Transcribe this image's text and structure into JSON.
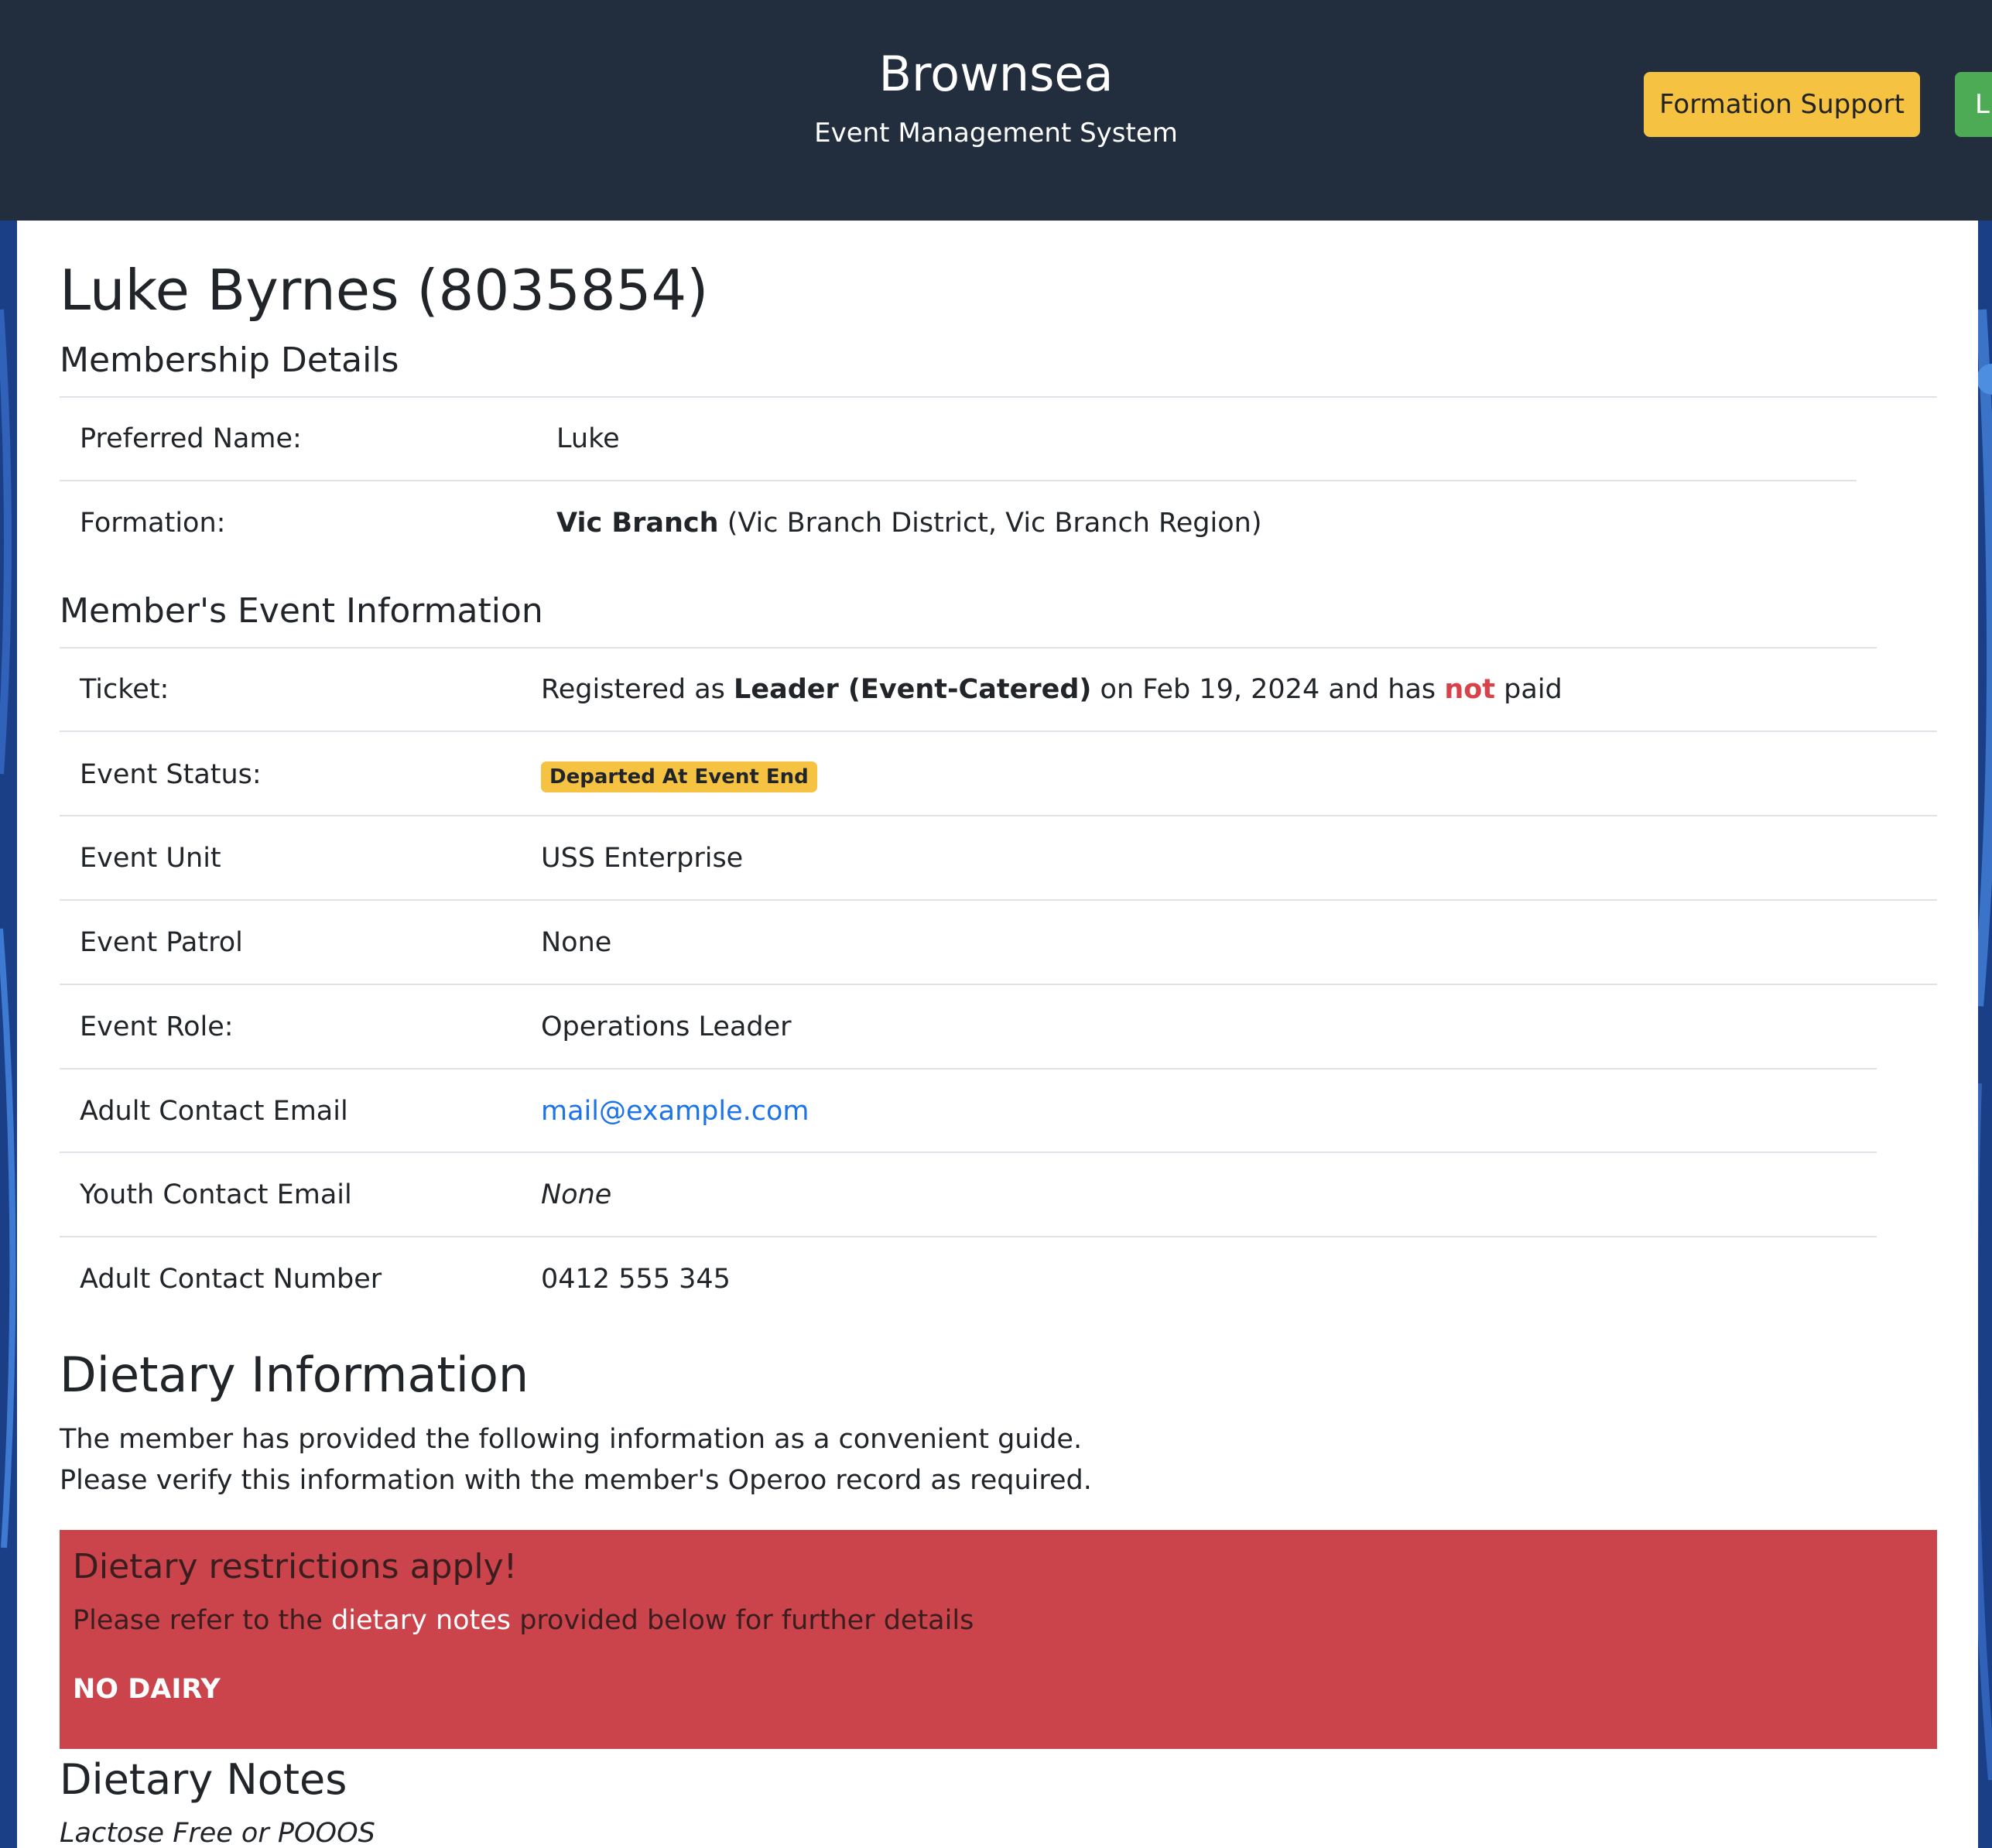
{
  "header": {
    "title": "Brownsea",
    "subtitle": "Event Management System",
    "support_button": "Formation Support",
    "right_button": "L"
  },
  "member": {
    "heading": "Luke Byrnes (8035854)"
  },
  "membership": {
    "title": "Membership Details",
    "preferred_name_label": "Preferred Name:",
    "preferred_name": "Luke",
    "formation_label": "Formation:",
    "formation_name": "Vic Branch",
    "formation_detail": "(Vic Branch District, Vic Branch Region)"
  },
  "event_info": {
    "title": "Member's Event Information",
    "ticket_label": "Ticket:",
    "ticket_prefix": "Registered as",
    "ticket_type": "Leader (Event-Catered)",
    "ticket_mid": "on Feb 19, 2024 and has",
    "ticket_not": "not",
    "ticket_suffix": "paid",
    "status_label": "Event Status:",
    "status_badge": "Departed At Event End",
    "unit_label": "Event Unit",
    "unit": "USS Enterprise",
    "patrol_label": "Event Patrol",
    "patrol": "None",
    "role_label": "Event Role:",
    "role": "Operations Leader",
    "adult_email_label": "Adult Contact Email",
    "adult_email": "mail@example.com",
    "youth_email_label": "Youth Contact Email",
    "youth_email": "None",
    "adult_number_label": "Adult Contact Number",
    "adult_number": "0412 555 345"
  },
  "dietary": {
    "title": "Dietary Information",
    "line1": "The member has provided the following information as a convenient guide.",
    "line2": "Please verify this information with the member's Operoo record as required.",
    "alert_title": "Dietary restrictions apply!",
    "alert_prefix": "Please refer to the",
    "alert_link": "dietary notes",
    "alert_suffix": "provided below for further details",
    "alert_strong": "NO DAIRY",
    "notes_title": "Dietary Notes",
    "notes": "Lactose Free or POOOS"
  },
  "colors": {
    "header_bg": "#222e3d",
    "support_button": "#f5c242",
    "green_button": "#4cab54",
    "alert_bg": "#cb444b",
    "link": "#1d73e8",
    "not_paid": "#d8434a",
    "page_bg": "#1b3f86"
  }
}
